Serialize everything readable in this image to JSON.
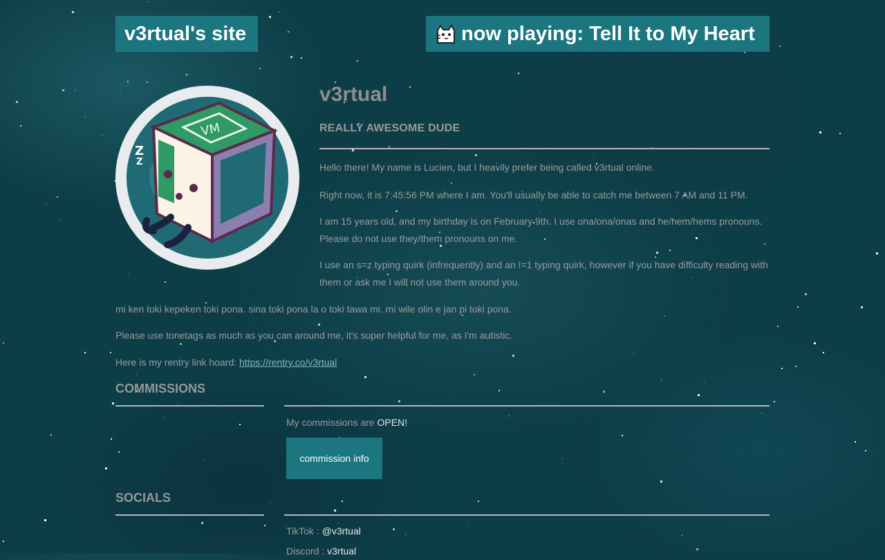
{
  "header": {
    "site_title": "v3rtual's site",
    "now_playing": "now playing: Tell It to My Heart",
    "now_playing_icon": "cat-icon"
  },
  "profile": {
    "name": "v3rtual",
    "tagline": "REALLY AWESOME DUDE",
    "avatar_icon": "sleepy-cube-avatar",
    "bio": [
      "Hello there! My name is Lucien, but I heavily prefer being called v3rtual online.",
      "Right now, it is 7:45:56 PM where I am. You'll usually be able to catch me between 7 AM and 11 PM.",
      "I am 15 years old, and my birthday is on February 9th. I use ona/ona/onas and he/hem/hems pronouns. Please do not use they/them pronouns on me.",
      "I use an s=z typing quirk (infrequently) and an !=1 typing quirk, however if you have difficulty reading with them or ask me I will not use them around you.",
      "mi ken toki kepeken toki pona. sina toki pona la o toki tawa mi. mi wile olin e jan pi toki pona.",
      "Please use tonetags as much as you can around me, it's super helpful for me, as I'm autistic."
    ],
    "rentry_prefix": "Here is my rentry link hoard: ",
    "rentry_link": "https://rentry.co/v3rtual"
  },
  "commissions": {
    "heading": "COMMISSIONS",
    "status_prefix": "My commissions are ",
    "status_value": "OPEN!",
    "button_label": "commission info"
  },
  "socials": {
    "heading": "SOCIALS",
    "items": [
      {
        "platform": "TikTok : ",
        "handle": "@v3rtual"
      },
      {
        "platform": "Discord : ",
        "handle": "v3rtual"
      }
    ]
  },
  "colors": {
    "accent": "#1b7680",
    "background": "#0d3d47",
    "text": "#9b9b9b"
  }
}
